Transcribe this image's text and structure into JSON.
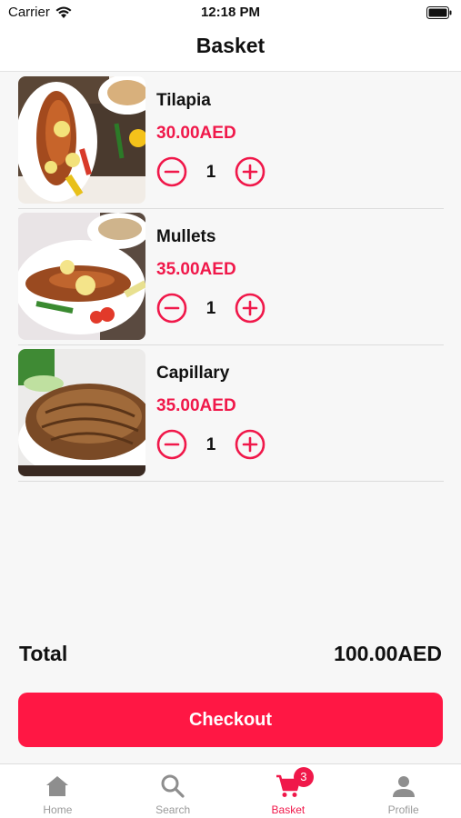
{
  "status_bar": {
    "carrier": "Carrier",
    "time": "12:18 PM"
  },
  "nav": {
    "title": "Basket"
  },
  "basket": {
    "items": [
      {
        "name": "Tilapia",
        "price": "30.00AED",
        "quantity": "1",
        "image_icon": "fish-dish-photo"
      },
      {
        "name": "Mullets",
        "price": "35.00AED",
        "quantity": "1",
        "image_icon": "fish-dish-photo"
      },
      {
        "name": "Capillary",
        "price": "35.00AED",
        "quantity": "1",
        "image_icon": "fish-dish-photo"
      }
    ]
  },
  "summary": {
    "total_label": "Total",
    "total_value": "100.00AED"
  },
  "checkout": {
    "label": "Checkout"
  },
  "tab_bar": {
    "tabs": [
      {
        "label": "Home",
        "icon": "home-icon",
        "active": false
      },
      {
        "label": "Search",
        "icon": "search-icon",
        "active": false
      },
      {
        "label": "Basket",
        "icon": "cart-icon",
        "active": true,
        "badge": "3"
      },
      {
        "label": "Profile",
        "icon": "person-icon",
        "active": false
      }
    ]
  },
  "colors": {
    "accent": "#f0184a",
    "button": "#ff1744",
    "inactive_tab": "#9a9a9a"
  }
}
